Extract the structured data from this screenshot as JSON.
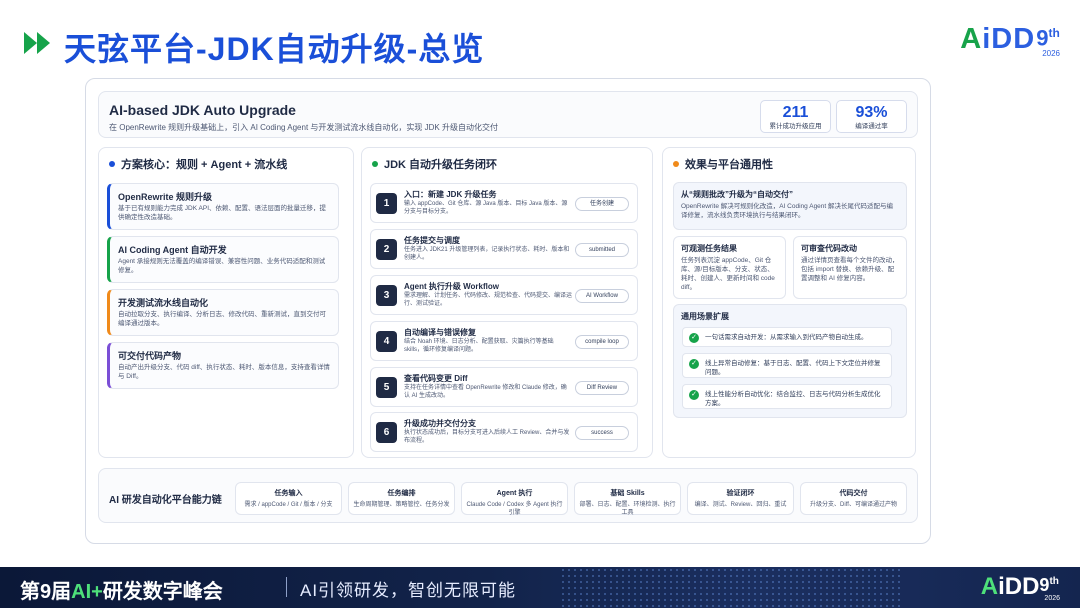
{
  "header": {
    "title": "天弦平台-JDK自动升级-总览",
    "logo_prefix": "A",
    "logo_main": "iDD",
    "logo_9": "9",
    "logo_th": "th",
    "logo_year": "2026"
  },
  "overview": {
    "title": "AI-based JDK Auto Upgrade",
    "subtitle": "在 OpenRewrite 规则升级基础上，引入 AI Coding Agent 与开发测试流水线自动化，实现 JDK 升级自动化交付",
    "stats": [
      {
        "value": "211",
        "label": "累计成功升级应用"
      },
      {
        "value": "93%",
        "label": "编译通过率"
      }
    ]
  },
  "left": {
    "heading": "方案核心：规则 + Agent + 流水线",
    "cards": [
      {
        "title": "OpenRewrite 规则升级",
        "desc": "基于已有规则能力完成 JDK API、依赖、配置、语法层面的批量迁移，提供确定性改造基础。"
      },
      {
        "title": "AI Coding Agent 自动开发",
        "desc": "Agent 承接规则无法覆盖的编译错误、兼容性问题、业务代码适配和测试修复。"
      },
      {
        "title": "开发测试流水线自动化",
        "desc": "自动拉取分支、执行编译、分析日志、修改代码、重新测试，直到交付可编译通过版本。"
      },
      {
        "title": "可交付代码产物",
        "desc": "自动产出升级分支、代码 diff、执行状态、耗时、版本信息，支持查看详情与 Diff。"
      }
    ]
  },
  "middle": {
    "heading": "JDK 自动升级任务闭环",
    "steps": [
      {
        "num": "1",
        "title": "入口：新建 JDK 升级任务",
        "desc": "输入 appCode、Git 仓库、源 Java 版本、目标 Java 版本、源分支与目标分支。",
        "tag": "任务创建"
      },
      {
        "num": "2",
        "title": "任务提交与调度",
        "desc": "任务进入 JDK21 升级管理列表，记录执行状态、耗时、版本和创建人。",
        "tag": "submitted"
      },
      {
        "num": "3",
        "title": "Agent 执行升级 Workflow",
        "desc": "需求理解、计划任务、代码修改、规范检查、代码提交、编译运行、测试验证。",
        "tag": "AI Workflow"
      },
      {
        "num": "4",
        "title": "自动编译与错误修复",
        "desc": "结合 Noah 环境、日志分析、配置获取、灾篇执行等基础 skills，循环修复编译问题。",
        "tag": "compile loop"
      },
      {
        "num": "5",
        "title": "查看代码变更 Diff",
        "desc": "支持在任务详情中查看 OpenRewrite 修改和 Claude 修改，确认 AI 生成改动。",
        "tag": "Diff Review"
      },
      {
        "num": "6",
        "title": "升级成功并交付分支",
        "desc": "执行状态成功后，目标分支可进入后续人工 Review、合并与发布流程。",
        "tag": "success"
      }
    ]
  },
  "right": {
    "heading": "效果与平台通用性",
    "hero": {
      "title": "从“规则批改”升级为“自动交付”",
      "desc": "OpenRewrite 解决可规则化改造，AI Coding Agent 解决长尾代码适配与编译修复，流水线负责环境执行与结果闭环。"
    },
    "box_a": {
      "title": "可观测任务结果",
      "desc": "任务列表沉淀 appCode、Git 仓库、源/目标版本、分支、状态、耗时、创建人、更新时间和 code diff。"
    },
    "box_b": {
      "title": "可审查代码改动",
      "desc": "通过详情页查看每个文件的改动，包括 import 替换、依赖升级、配置调整和 AI 修复内容。"
    },
    "scenarios": {
      "title": "通用场景扩展",
      "items": [
        "一句话需求自动开发：从需求输入到代码产物自动生成。",
        "线上异常自动修复：基于日志、配置、代码上下文定位并修复问题。",
        "线上性能分析自动优化：结合监控、日志与代码分析生成优化方案。"
      ]
    }
  },
  "chain": {
    "title": "AI 研发自动化平台能力链",
    "items": [
      {
        "title": "任务输入",
        "desc": "需求 / appCode / Git / 版本 / 分支"
      },
      {
        "title": "任务编排",
        "desc": "生命周期管理、策略管控、任务分发"
      },
      {
        "title": "Agent 执行",
        "desc": "Claude Code / Codex 多 Agent 执行引擎"
      },
      {
        "title": "基础 Skills",
        "desc": "部署、日志、配置、环境检测、执行工具"
      },
      {
        "title": "验证闭环",
        "desc": "编译、测试、Review、回归、重试"
      },
      {
        "title": "代码交付",
        "desc": "升级分支、Diff、可编译通过产物"
      }
    ]
  },
  "footer": {
    "event": "第9届",
    "ai": "AI+",
    "event_rest": "研发数字峰会",
    "slogan": "AI引领研发，智创无限可能",
    "logo_prefix": "A",
    "logo_main": "iDD",
    "logo_9": "9",
    "logo_th": "th",
    "logo_year": "2026"
  },
  "colors": {
    "primary": "#1a4fd8",
    "green": "#16a34a",
    "orange": "#f08a1a",
    "purple": "#7b4fd6",
    "footer_bg": "#0b1838"
  }
}
